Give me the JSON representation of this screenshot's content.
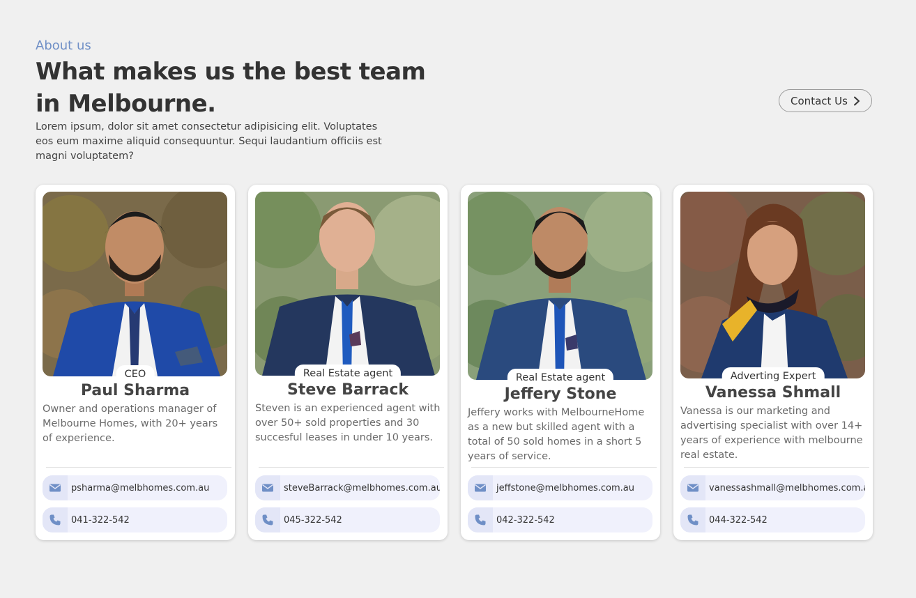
{
  "header": {
    "eyebrow": "About us",
    "title": "What makes us the best team in Melbourne.",
    "intro": "Lorem ipsum, dolor sit amet consectetur adipisicing elit. Voluptates eos eum maxime aliquid consequuntur. Sequi laudantium officiis est magni voluptatem?",
    "contact_label": "Contact Us"
  },
  "team": [
    {
      "role": "CEO",
      "name": "Paul Sharma",
      "description": "Owner and operations manager of Melbourne Homes, with 20+ years of experience.",
      "email": "psharma@melbhomes.com.au",
      "phone": "041-322-542"
    },
    {
      "role": "Real Estate agent",
      "name": "Steve Barrack",
      "description": "Steven is an experienced agent with over 50+ sold properties and 30 succesful leases in under 10 years.",
      "email": "steveBarrack@melbhomes.com.au",
      "phone": "045-322-542"
    },
    {
      "role": "Real Estate agent",
      "name": "Jeffery Stone",
      "description": "Jeffery works with MelbourneHome as a new but skilled agent with a total of 50 sold homes in a short 5 years of service.",
      "email": "jeffstone@melbhomes.com.au",
      "phone": "042-322-542"
    },
    {
      "role": "Adverting Expert",
      "name": "Vanessa Shmall",
      "description": "Vanessa is our marketing and advertising specialist with over 14+ years of experience with melbourne real estate.",
      "email": "vanessashmall@melbhomes.com.au",
      "phone": "044-322-542"
    }
  ],
  "icons": {
    "email": "envelope-icon",
    "phone": "phone-icon",
    "chevron": "chevron-right-icon"
  },
  "colors": {
    "background": "#f0f0f0",
    "accent": "#6f8fc6",
    "pill": "#f0f1fc",
    "icon": "#6f8fc6"
  }
}
